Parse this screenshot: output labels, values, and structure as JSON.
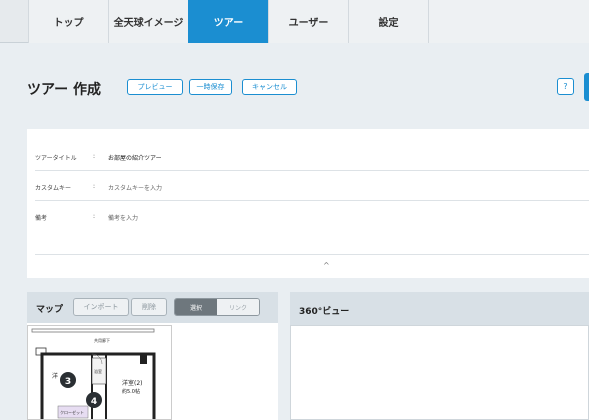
{
  "nav": {
    "tabs": [
      {
        "label": "トップ",
        "active": false
      },
      {
        "label": "全天球イメージ",
        "active": false
      },
      {
        "label": "ツアー",
        "active": true
      },
      {
        "label": "ユーザー",
        "active": false
      },
      {
        "label": "設定",
        "active": false
      }
    ]
  },
  "header": {
    "title": "ツアー 作成",
    "preview": "プレビュー",
    "temp_save": "一時保存",
    "cancel": "キャンセル",
    "help": "?"
  },
  "form": {
    "tour_title_label": "ツアータイトル",
    "tour_title_value": "お部屋の紹介ツアー",
    "custom_key_label": "カスタムキー",
    "custom_key_placeholder": "カスタムキーを入力",
    "note_label": "備考",
    "note_placeholder": "備考を入力",
    "colon": ":",
    "collapse_icon": "^"
  },
  "map": {
    "title": "マップ",
    "import": "インポート",
    "delete": "削除",
    "mode_select": "選択",
    "mode_link": "リンク",
    "floorplan": {
      "hall_label": "共用廊下",
      "room2_label": "洋室(2)",
      "room2_size": "約5.0帖",
      "room1_label": "洋",
      "bath_label": "浴室",
      "closet_label": "クローゼット",
      "mark_3": "3",
      "mark_4": "4"
    }
  },
  "viewer": {
    "title": "360°ビュー"
  },
  "colors": {
    "accent": "#1b8ed1",
    "panel_header": "#d8e0e6",
    "background": "#e9eef2"
  }
}
